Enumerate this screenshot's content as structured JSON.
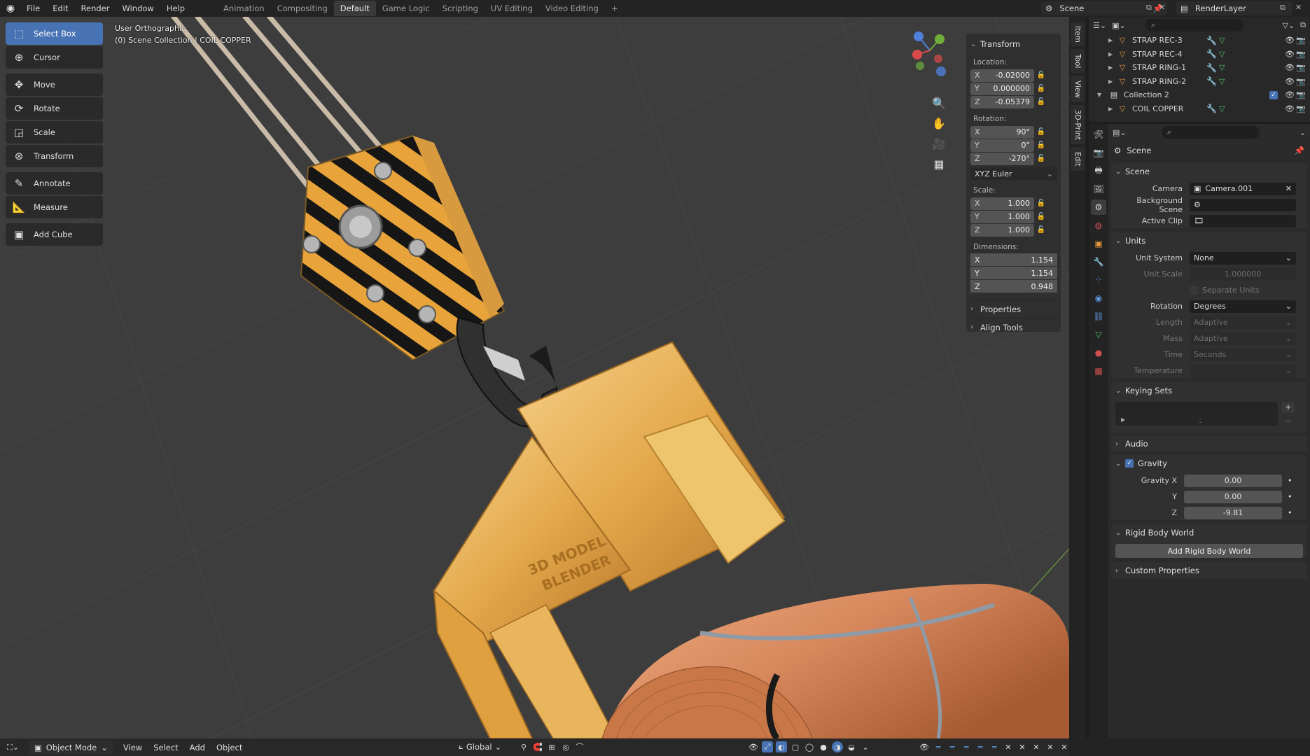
{
  "topbar": {
    "menus": [
      "File",
      "Edit",
      "Render",
      "Window",
      "Help"
    ],
    "workspaces": [
      "Animation",
      "Compositing",
      "Default",
      "Game Logic",
      "Scripting",
      "UV Editing",
      "Video Editing"
    ],
    "active_workspace": "Default",
    "scene_name": "Scene",
    "render_layer": "RenderLayer"
  },
  "viewport": {
    "view_name": "User Orthographic",
    "collection_path": "(0) Scene Collection | COIL COPPER",
    "model_text_line1": "3D MODEL",
    "model_text_line2": "BLENDER"
  },
  "tools": [
    {
      "label": "Select Box",
      "icon": "select-box-icon",
      "selected": true
    },
    {
      "label": "Cursor",
      "icon": "cursor-icon"
    },
    {
      "label": "Move",
      "icon": "move-icon"
    },
    {
      "label": "Rotate",
      "icon": "rotate-icon"
    },
    {
      "label": "Scale",
      "icon": "scale-icon"
    },
    {
      "label": "Transform",
      "icon": "transform-icon"
    },
    {
      "label": "Annotate",
      "icon": "annotate-icon"
    },
    {
      "label": "Measure",
      "icon": "measure-icon"
    },
    {
      "label": "Add Cube",
      "icon": "add-cube-icon"
    }
  ],
  "npanel": {
    "transform_title": "Transform",
    "location_label": "Location:",
    "location": [
      {
        "axis": "X",
        "value": "-0.02000"
      },
      {
        "axis": "Y",
        "value": "0.000000"
      },
      {
        "axis": "Z",
        "value": "-0.05379"
      }
    ],
    "rotation_label": "Rotation:",
    "rotation": [
      {
        "axis": "X",
        "value": "90°"
      },
      {
        "axis": "Y",
        "value": "0°"
      },
      {
        "axis": "Z",
        "value": "-270°"
      }
    ],
    "rotation_mode": "XYZ Euler",
    "scale_label": "Scale:",
    "scale": [
      {
        "axis": "X",
        "value": "1.000"
      },
      {
        "axis": "Y",
        "value": "1.000"
      },
      {
        "axis": "Z",
        "value": "1.000"
      }
    ],
    "dimensions_label": "Dimensions:",
    "dimensions": [
      {
        "axis": "X",
        "value": "1.154"
      },
      {
        "axis": "Y",
        "value": "1.154"
      },
      {
        "axis": "Z",
        "value": "0.948"
      }
    ],
    "properties_label": "Properties",
    "align_tools_label": "Align Tools"
  },
  "sidebar_tabs": [
    "Item",
    "Tool",
    "View",
    "3D-Print",
    "Edit"
  ],
  "outliner": {
    "rows": [
      {
        "name": "STRAP REC-3",
        "indent": 1
      },
      {
        "name": "STRAP REC-4",
        "indent": 1
      },
      {
        "name": "STRAP RING-1",
        "indent": 1
      },
      {
        "name": "STRAP RING-2",
        "indent": 1
      },
      {
        "name": "Collection 2",
        "indent": 0
      },
      {
        "name": "COIL COPPER",
        "indent": 1
      }
    ]
  },
  "properties": {
    "context": "Scene",
    "scene_section": "Scene",
    "camera_label": "Camera",
    "camera_value": "Camera.001",
    "background_scene_label": "Background Scene",
    "active_clip_label": "Active Clip",
    "units_section": "Units",
    "unit_system_label": "Unit System",
    "unit_system_value": "None",
    "unit_scale_label": "Unit Scale",
    "unit_scale_value": "1.000000",
    "separate_units_label": "Separate Units",
    "rotation_label": "Rotation",
    "rotation_value": "Degrees",
    "length_label": "Length",
    "length_value": "Adaptive",
    "mass_label": "Mass",
    "mass_value": "Adaptive",
    "time_label": "Time",
    "time_value": "Seconds",
    "temperature_label": "Temperature",
    "keying_sets_section": "Keying Sets",
    "audio_section": "Audio",
    "gravity_section": "Gravity",
    "gravity_x_label": "Gravity X",
    "gravity_x": "0.00",
    "gravity_y_label": "Y",
    "gravity_y": "0.00",
    "gravity_z_label": "Z",
    "gravity_z": "-9.81",
    "rigid_body_section": "Rigid Body World",
    "add_rigid_body_label": "Add Rigid Body World",
    "custom_props_section": "Custom Properties"
  },
  "bottombar": {
    "mode": "Object Mode",
    "menus": [
      "View",
      "Select",
      "Add",
      "Object"
    ],
    "orientation": "Global"
  },
  "colors": {
    "accent": "#4772b3",
    "viewport_bg": "#3d3d3d",
    "gold": "#e3a84a",
    "copper": "#d8895e"
  }
}
